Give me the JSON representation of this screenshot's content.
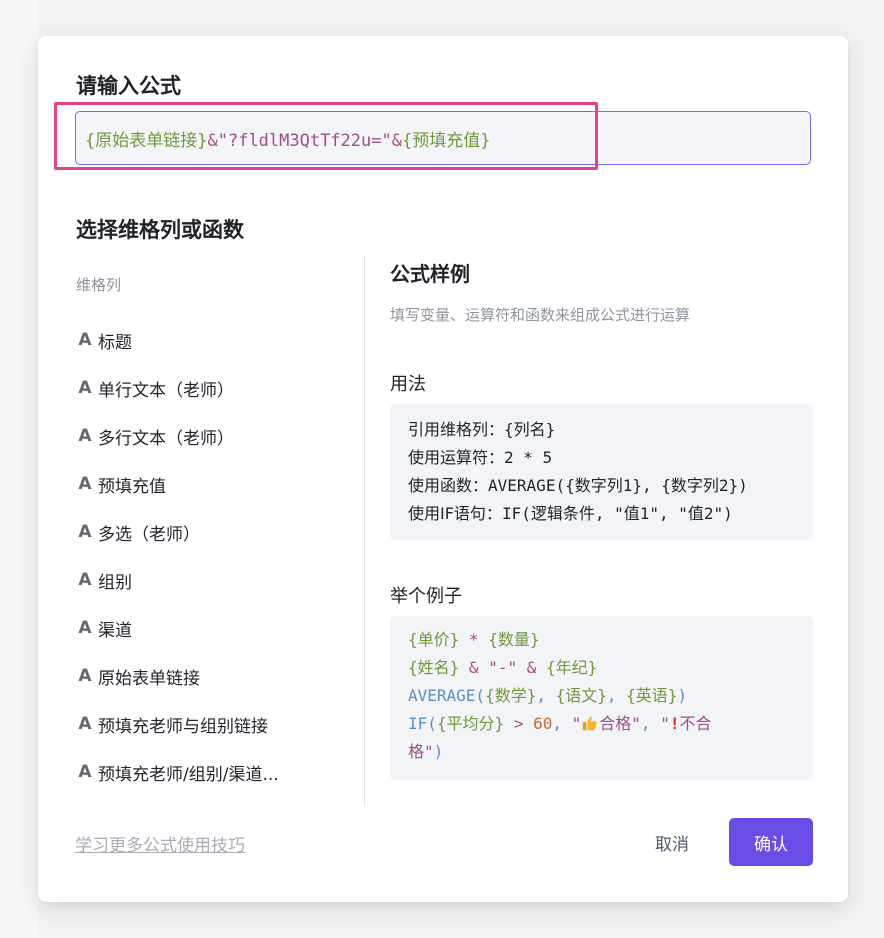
{
  "dialog": {
    "title": "请输入公式",
    "formula": {
      "part1": "{原始表单链接}",
      "op1": "&",
      "str": "\"?fldlM3QtTf22u=\"",
      "op2": "&",
      "part2": "{预填充值}"
    },
    "select_title": "选择维格列或函数"
  },
  "columns": {
    "header": "维格列",
    "icon_glyph": "A",
    "items": [
      {
        "label": "标题"
      },
      {
        "label": "单行文本（老师）"
      },
      {
        "label": "多行文本（老师）"
      },
      {
        "label": "预填充值"
      },
      {
        "label": "多选（老师）"
      },
      {
        "label": "组别"
      },
      {
        "label": "渠道"
      },
      {
        "label": "原始表单链接"
      },
      {
        "label": "预填充老师与组别链接"
      },
      {
        "label": "预填充老师/组别/渠道..."
      }
    ]
  },
  "sample": {
    "title": "公式样例",
    "description": "填写变量、运算符和函数来组成公式进行运算",
    "usage_title": "用法",
    "usage_lines": [
      {
        "label": "引用维格列：",
        "code": "{列名}"
      },
      {
        "label": "使用运算符：",
        "code": "2 * 5"
      },
      {
        "label": "使用函数：",
        "code": "AVERAGE({数字列1}, {数字列2})"
      },
      {
        "label": "使用IF语句：",
        "code": "IF(逻辑条件, \"值1\", \"值2\")"
      }
    ],
    "example_title": "举个例子",
    "example": {
      "l1_a": "{单价}",
      "l1_op": " * ",
      "l1_b": "{数量}",
      "l2_a": "{姓名}",
      "l2_op1": " & ",
      "l2_str": "\"-\"",
      "l2_op2": " & ",
      "l2_b": "{年纪}",
      "l3_fn": "AVERAGE(",
      "l3_a": "{数学}",
      "l3_sep1": ", ",
      "l3_b": "{语文}",
      "l3_sep2": ", ",
      "l3_c": "{英语}",
      "l3_close": ")",
      "l4_fn": "IF(",
      "l4_a": "{平均分}",
      "l4_op": " > ",
      "l4_num": "60",
      "l4_sep": ", ",
      "l4_q1": "\"",
      "l4_pass": "合格",
      "l4_q1e": "\"",
      "l4_sep2": ", ",
      "l4_q2": "\"",
      "l4_fail": "不合",
      "l5_fail": "格\"",
      "l5_close": ")"
    }
  },
  "footer": {
    "help_link": "学习更多公式使用技巧",
    "cancel": "取消",
    "confirm": "确认"
  },
  "colors": {
    "accent": "#6b4de6",
    "highlight_frame": "#e8408a",
    "field_token": "#6f9a3a",
    "operator_token": "#b34c7b"
  }
}
